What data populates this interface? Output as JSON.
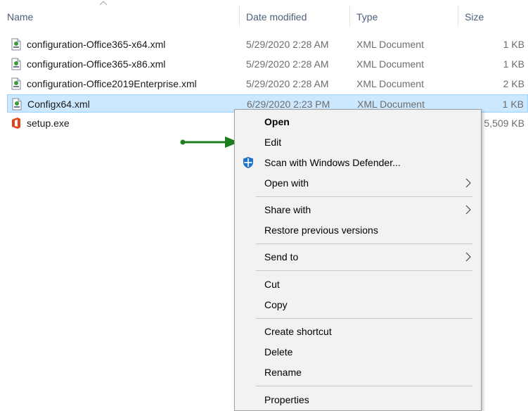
{
  "columns": {
    "name": "Name",
    "date": "Date modified",
    "type": "Type",
    "size": "Size"
  },
  "files": [
    {
      "name": "configuration-Office365-x64.xml",
      "date": "5/29/2020 2:28 AM",
      "type": "XML Document",
      "size": "1 KB",
      "icon": "xml-file-icon"
    },
    {
      "name": "configuration-Office365-x86.xml",
      "date": "5/29/2020 2:28 AM",
      "type": "XML Document",
      "size": "1 KB",
      "icon": "xml-file-icon"
    },
    {
      "name": "configuration-Office2019Enterprise.xml",
      "date": "5/29/2020 2:28 AM",
      "type": "XML Document",
      "size": "2 KB",
      "icon": "xml-file-icon"
    },
    {
      "name": "Configx64.xml",
      "date": "6/29/2020 2:23 PM",
      "type": "XML Document",
      "size": "1 KB",
      "icon": "xml-file-icon",
      "selected": true
    },
    {
      "name": "setup.exe",
      "date": "",
      "type": "",
      "size": "5,509 KB",
      "icon": "office-icon"
    }
  ],
  "context_menu": {
    "items": [
      {
        "label": "Open",
        "bold": true
      },
      {
        "label": "Edit"
      },
      {
        "label": "Scan with Windows Defender...",
        "icon": "windows-defender-icon"
      },
      {
        "label": "Open with",
        "submenu": true
      },
      {
        "label": "Share with",
        "submenu": true
      },
      {
        "label": "Restore previous versions"
      },
      {
        "label": "Send to",
        "submenu": true
      },
      {
        "label": "Cut"
      },
      {
        "label": "Copy"
      },
      {
        "label": "Create shortcut"
      },
      {
        "label": "Delete"
      },
      {
        "label": "Rename"
      },
      {
        "label": "Properties"
      }
    ]
  },
  "colors": {
    "selection": "#cce8ff",
    "arrow": "#1e7d1e",
    "header_text": "#4c607a"
  }
}
